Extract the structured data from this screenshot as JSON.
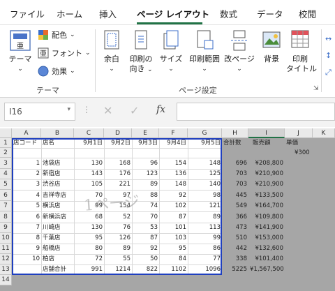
{
  "tabs": [
    "ファイル",
    "ホーム",
    "挿入",
    "ページ レイアウト",
    "数式",
    "データ",
    "校閲"
  ],
  "ribbon": {
    "theme_group": {
      "theme_label": "テーマ",
      "colors_label": "配色",
      "fonts_label": "フォント",
      "effects_label": "効果",
      "group_label": "テーマ"
    },
    "page_setup_group": {
      "margins": "余白",
      "orientation_1": "印刷の",
      "orientation_2": "向き",
      "size": "サイズ",
      "print_area": "印刷範囲",
      "breaks": "改ページ",
      "background": "背景",
      "print_titles_1": "印刷",
      "print_titles_2": "タイトル",
      "group_label": "ページ設定"
    }
  },
  "formula_bar": {
    "name_box": "I16",
    "fx": "fx",
    "formula": ""
  },
  "columns": [
    "A",
    "B",
    "C",
    "D",
    "E",
    "F",
    "G",
    "H",
    "I",
    "J",
    "K"
  ],
  "selected_column": "I",
  "rows": [
    "1",
    "2",
    "3",
    "4",
    "5",
    "6",
    "7",
    "8",
    "9",
    "10",
    "11",
    "12",
    "13",
    "14"
  ],
  "watermark": "1ページ",
  "table": {
    "headers": [
      "店コード",
      "店名",
      "9月1日",
      "9月2日",
      "9月3日",
      "9月4日",
      "9月5日",
      "合計数",
      "販売額",
      "単価"
    ],
    "unit_price": "¥300",
    "data": [
      [
        "1",
        "池袋店",
        "130",
        "168",
        "96",
        "154",
        "148",
        "696",
        "¥208,800"
      ],
      [
        "2",
        "新宿店",
        "143",
        "176",
        "123",
        "136",
        "125",
        "703",
        "¥210,900"
      ],
      [
        "3",
        "渋谷店",
        "105",
        "221",
        "89",
        "148",
        "140",
        "703",
        "¥210,900"
      ],
      [
        "4",
        "吉祥寺店",
        "70",
        "97",
        "88",
        "92",
        "98",
        "445",
        "¥133,500"
      ],
      [
        "5",
        "横浜店",
        "99",
        "154",
        "97",
        "74",
        "102",
        "121",
        "549",
        "¥164,700"
      ],
      [
        "6",
        "新横浜店",
        "68",
        "52",
        "70",
        "87",
        "89",
        "366",
        "¥109,800"
      ],
      [
        "7",
        "川崎店",
        "130",
        "76",
        "53",
        "101",
        "113",
        "473",
        "¥141,900"
      ],
      [
        "8",
        "千葉店",
        "95",
        "126",
        "87",
        "103",
        "99",
        "510",
        "¥153,000"
      ],
      [
        "9",
        "船橋店",
        "80",
        "89",
        "92",
        "95",
        "86",
        "442",
        "¥132,600"
      ],
      [
        "10",
        "柏店",
        "72",
        "55",
        "50",
        "84",
        "77",
        "338",
        "¥101,400"
      ]
    ],
    "total": [
      "",
      "店舗合計",
      "991",
      "1214",
      "822",
      "1102",
      "1096",
      "5225",
      "¥1,567,500"
    ]
  }
}
